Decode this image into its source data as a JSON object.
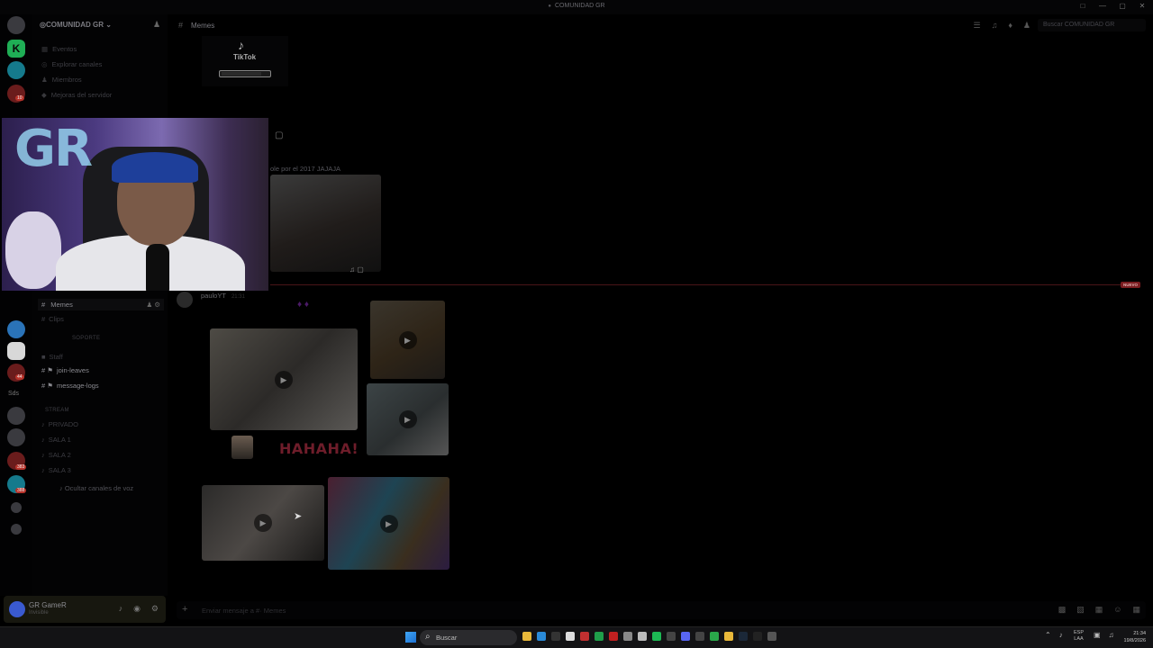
{
  "window": {
    "title": "COMUNIDAD GR",
    "controls": [
      "□",
      "—",
      "▢",
      "✕"
    ]
  },
  "server_rail": {
    "servers": [
      "discord-home",
      "server-k",
      "server-gr",
      "server-3",
      "server-4",
      "server-5",
      "server-6",
      "server-7",
      "server-8",
      "server-9",
      "server-10"
    ],
    "badges": [
      "10",
      "44",
      "383",
      "388",
      "283"
    ],
    "text_server": "Sds"
  },
  "sidebar": {
    "server_name": "COMUNIDAD GR",
    "menu": [
      {
        "label": "Eventos",
        "icon": "calendar-icon"
      },
      {
        "label": "Explorar canales",
        "icon": "compass-icon"
      },
      {
        "label": "Miembros",
        "icon": "members-icon"
      },
      {
        "label": "Mejoras del servidor",
        "icon": "boost-icon"
      }
    ],
    "channels": [
      {
        "label": "Memes",
        "prefix": "#",
        "active": true
      },
      {
        "label": "Clips",
        "prefix": "#",
        "active": false
      }
    ],
    "category_support": "SOPORTE",
    "staff_channel": "Staff",
    "log_channels": [
      "join-leaves",
      "message-logs"
    ],
    "category_stream": "STREAM",
    "voice_channels": [
      "PRIVADO",
      "SALA 1",
      "SALA 2",
      "SALA 3"
    ],
    "hide_voice": "Ocultar canales de voz"
  },
  "user": {
    "name": "GR GameR",
    "status": "Invisible"
  },
  "chat": {
    "channel_name": "Memes",
    "search_placeholder": "Buscar COMUNIDAD GR",
    "tiktok_label": "TikTok",
    "message_text": "ole por el 2017 JAJAJA",
    "new_badge": "NUEVO",
    "author": "pauloYT",
    "time": "21:31",
    "hahaha_text": "HAHAHA!",
    "composer_placeholder": "Enviar mensaje a #· Memes"
  },
  "taskbar": {
    "search_label": "Buscar",
    "language_top": "ESP",
    "language_bottom": "LAA",
    "time": "21:34",
    "date": "19/8/2026"
  },
  "colors": {
    "accent_new": "#7a1c20",
    "server_green": "#1fae55",
    "webcam_purple": "#4b3a80"
  }
}
